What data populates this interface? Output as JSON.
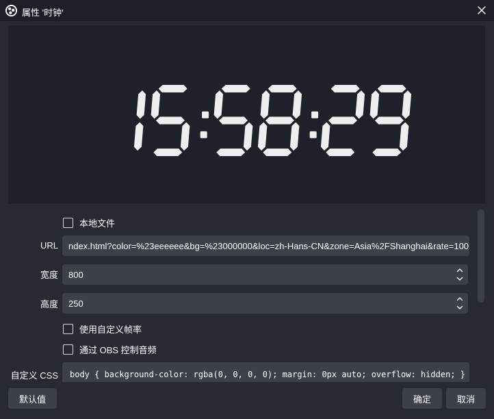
{
  "window": {
    "title": "属性 '时钟'",
    "app_icon": "obs-logo-icon",
    "close_icon": "close-icon"
  },
  "preview": {
    "clock_text": "15:58:29",
    "digit_color": "#eeeeee",
    "background": "#1f212a"
  },
  "form": {
    "local_file_label": "本地文件",
    "url_label": "URL",
    "url_value": "ndex.html?color=%23eeeeee&bg=%23000000&loc=zh-Hans-CN&zone=Asia%2FShanghai&rate=100",
    "width_label": "宽度",
    "width_value": "800",
    "height_label": "高度",
    "height_value": "250",
    "custom_fps_label": "使用自定义帧率",
    "obs_audio_label": "通过 OBS 控制音频",
    "custom_css_label": "自定义 CSS",
    "custom_css_value": "body { background-color: rgba(0, 0, 0, 0); margin: 0px auto; overflow: hidden; }"
  },
  "footer": {
    "defaults_label": "默认值",
    "ok_label": "确定",
    "cancel_label": "取消"
  },
  "colors": {
    "window_bg": "#272a33",
    "titlebar_bg": "#1d1f26",
    "input_bg": "#3c404b",
    "button_bg": "#3c404b",
    "text": "#ffffff"
  }
}
